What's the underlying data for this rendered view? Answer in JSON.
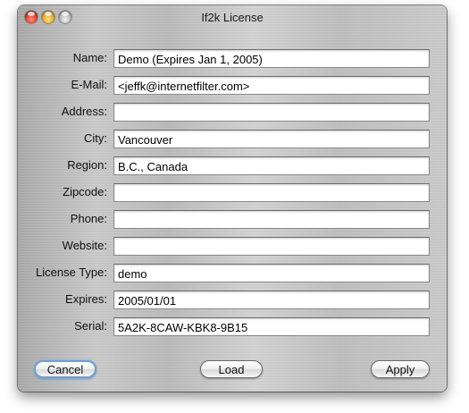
{
  "window": {
    "title": "If2k License"
  },
  "fields": [
    {
      "label": "Name:",
      "value": "Demo (Expires Jan 1, 2005)"
    },
    {
      "label": "E-Mail:",
      "value": "<jeffk@internetfilter.com>"
    },
    {
      "label": "Address:",
      "value": ""
    },
    {
      "label": "City:",
      "value": "Vancouver"
    },
    {
      "label": "Region:",
      "value": "B.C., Canada"
    },
    {
      "label": "Zipcode:",
      "value": ""
    },
    {
      "label": "Phone:",
      "value": ""
    },
    {
      "label": "Website:",
      "value": ""
    },
    {
      "label": "License Type:",
      "value": "demo"
    },
    {
      "label": "Expires:",
      "value": "2005/01/01"
    },
    {
      "label": "Serial:",
      "value": "5A2K-8CAW-KBK8-9B15"
    }
  ],
  "buttons": {
    "cancel": "Cancel",
    "load": "Load",
    "apply": "Apply"
  },
  "colors": {
    "focus_ring": "#6d9fd6",
    "close": "#d2281b",
    "minimize": "#d9971a",
    "zoom": "#a7a7a7"
  }
}
